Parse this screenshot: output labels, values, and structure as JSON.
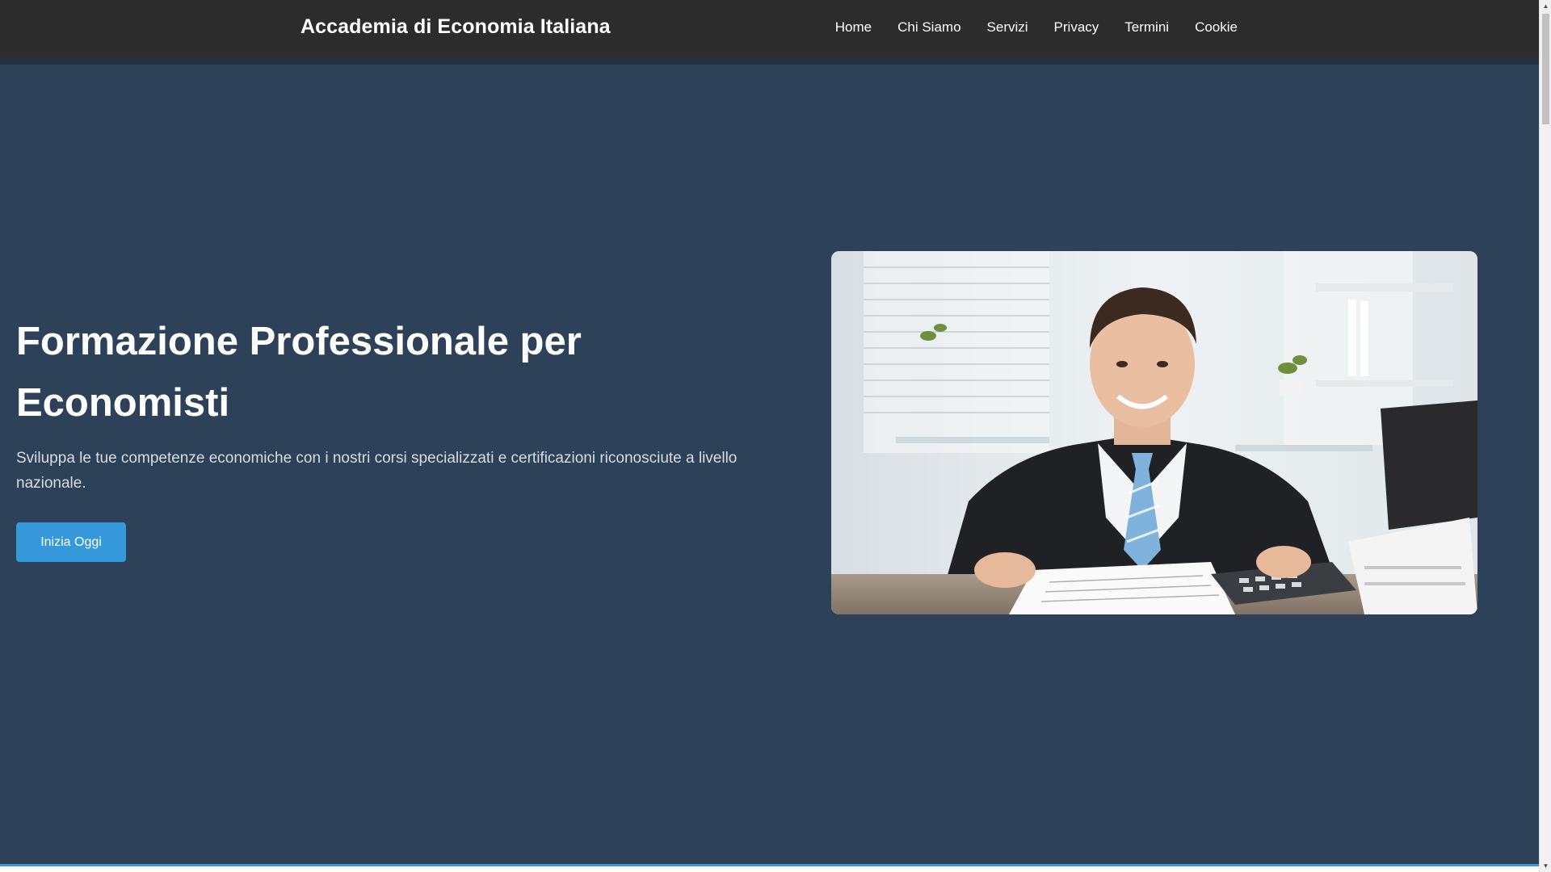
{
  "header": {
    "brand": "Accademia di Economia Italiana",
    "nav": [
      "Home",
      "Chi Siamo",
      "Servizi",
      "Privacy",
      "Termini",
      "Cookie"
    ]
  },
  "hero": {
    "title": "Formazione Professionale per Economisti",
    "subtitle": "Sviluppa le tue competenze economiche con i nostri corsi specializzati e certificazioni riconosciute a livello nazionale.",
    "cta_label": "Inizia Oggi",
    "image_icon": "businessman-photo"
  },
  "colors": {
    "header_bg": "#2c2c2c",
    "hero_bg": "#2d4158",
    "accent": "#3498db"
  },
  "scrollbar": {
    "up_icon": "chevron-up-icon",
    "down_icon": "chevron-down-icon"
  }
}
